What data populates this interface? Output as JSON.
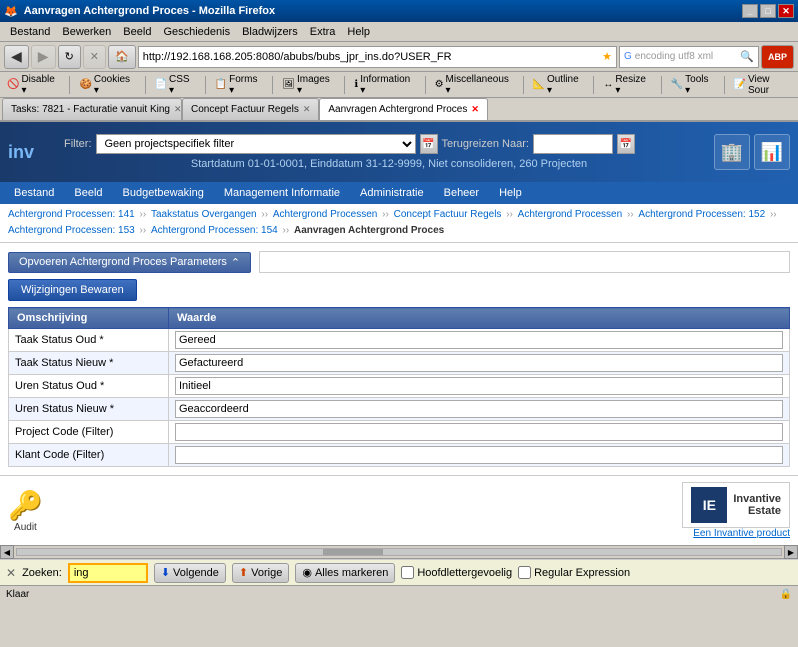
{
  "window": {
    "title": "Aanvragen Achtergrond Proces - Mozilla Firefox",
    "controls": [
      "minimize",
      "maximize",
      "close"
    ]
  },
  "browser_menu": {
    "items": [
      "Bestand",
      "Bewerken",
      "Beeld",
      "Geschiedenis",
      "Bladwijzers",
      "Extra",
      "Help"
    ]
  },
  "nav": {
    "address": "http://192.168.168.205:8080/abubs/bubs_jpr_ins.do?USER_FR",
    "search_placeholder": "encoding utf8 xml"
  },
  "toolbar": {
    "items": [
      "Disable ▾",
      "Cookies ▾",
      "CSS ▾",
      "Forms ▾",
      "Images ▾",
      "Information ▾",
      "Miscellaneous ▾",
      "Outline ▾",
      "Resize ▾",
      "Tools ▾",
      "View Sour"
    ]
  },
  "tabs": [
    {
      "id": "tab1",
      "label": "Tasks: 7821 - Facturatie vanuit King",
      "active": false,
      "closeable": true
    },
    {
      "id": "tab2",
      "label": "Concept Factuur Regels",
      "active": false,
      "closeable": true
    },
    {
      "id": "tab3",
      "label": "Aanvragen Achtergrond Proces",
      "active": true,
      "closeable": true
    }
  ],
  "app_header": {
    "logo": "inv",
    "filter_label": "Filter:",
    "filter_value": "Geen projectspecifiek filter",
    "teruggreizen_label": "Terugreizen Naar:",
    "teruggreizen_value": "",
    "info_text": "Startdatum 01-01-0001, Einddatum 31-12-9999, Niet consolideren, 260 Projecten"
  },
  "app_menu": {
    "items": [
      "Bestand",
      "Beeld",
      "Budgetbewaking",
      "Management Informatie",
      "Administratie",
      "Beheer",
      "Help"
    ]
  },
  "breadcrumb": {
    "items": [
      "Achtergrond Processen: 141",
      "Taakstatus Overgangen",
      "Achtergrond Processen",
      "Concept Factuur Regels",
      "Achtergrond Processen",
      "Achtergrond Processen: 152",
      "Achtergrond Processen: 153",
      "Achtergrond Processen: 154",
      "Aanvragen Achtergrond Proces"
    ],
    "current": "Aanvragen Achtergrond Proces"
  },
  "section": {
    "title": "Opvoeren Achtergrond Proces Parameters",
    "collapse_icon": "⌃",
    "save_button": "Wijzigingen Bewaren"
  },
  "table": {
    "headers": [
      "Omschrijving",
      "Waarde"
    ],
    "rows": [
      {
        "label": "Taak Status Oud *",
        "value": "Gereed",
        "field_name": "taak-status-oud"
      },
      {
        "label": "Taak Status Nieuw *",
        "value": "Gefactureerd",
        "field_name": "taak-status-nieuw"
      },
      {
        "label": "Uren Status Oud *",
        "value": "Initieel",
        "field_name": "uren-status-oud"
      },
      {
        "label": "Uren Status Nieuw *",
        "value": "Geaccordeerd",
        "field_name": "uren-status-nieuw"
      },
      {
        "label": "Project Code (Filter)",
        "value": "",
        "field_name": "project-code"
      },
      {
        "label": "Klant Code (Filter)",
        "value": "",
        "field_name": "klant-code"
      }
    ]
  },
  "footer": {
    "audit_label": "Audit",
    "brand_name": "Invantive\nEstate",
    "brand_tagline": "Een Invantive product"
  },
  "find_bar": {
    "close": "✕",
    "label": "Zoeken:",
    "value": "ing",
    "next_btn": "Volgende",
    "prev_btn": "Vorige",
    "mark_btn": "Alles markeren",
    "case_label": "Hoofdlettergevoelig",
    "regex_label": "Regular Expression"
  },
  "status_bar": {
    "text": "Klaar"
  },
  "colors": {
    "accent_blue": "#2060b0",
    "dark_blue": "#1a3a6b",
    "btn_blue": "#4060a0",
    "header_blue": "#6080b0"
  }
}
